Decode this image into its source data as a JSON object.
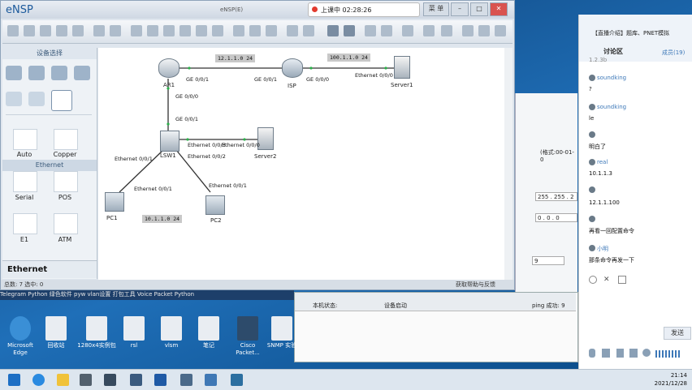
{
  "app": {
    "name": "eNSP",
    "window_title": "eNSP(E)",
    "recording": "上课中 02:28:26",
    "menu_label": "菜 单"
  },
  "left_panel": {
    "header": "设备选择",
    "section": "Ethernet",
    "cables": [
      {
        "label": "Auto",
        "icon": "auto-cable-icon"
      },
      {
        "label": "Copper",
        "icon": "copper-cable-icon"
      },
      {
        "label": "Serial",
        "icon": "serial-cable-icon"
      },
      {
        "label": "POS",
        "icon": "pos-cable-icon"
      },
      {
        "label": "E1",
        "icon": "e1-cable-icon"
      },
      {
        "label": "ATM",
        "icon": "atm-cable-icon"
      }
    ],
    "footer": "Ethernet"
  },
  "topology": {
    "net_ar1_isp": "12.1.1.0 24",
    "net_isp_server": "100.1.1.0 24",
    "net_lan": "10.1.1.0 24",
    "devices": {
      "ar1": "AR1",
      "isp": "ISP",
      "server1": "Server1",
      "lsw1": "LSW1",
      "server2": "Server2",
      "pc1": "PC1",
      "pc2": "PC2"
    },
    "ports": {
      "ar1_ge001": "GE 0/0/1",
      "isp_ge001": "GE 0/0/1",
      "isp_ge000": "GE 0/0/0",
      "server1_eth": "Ethernet 0/0/0",
      "ar1_ge000": "GE 0/0/0",
      "lsw1_ge001": "GE 0/0/1",
      "lsw1_e003": "Ethernet 0/0/3",
      "server2_eth": "Ethernet 0/0/0",
      "lsw1_e001": "Ethernet 0/0/1",
      "lsw1_e002": "Ethernet 0/0/2",
      "pc1_eth": "Ethernet 0/0/1",
      "pc2_eth": "Ethernet 0/0/1"
    }
  },
  "status_bar": {
    "left": "总数: 7  选中: 0",
    "right": "获取帮助与反馈"
  },
  "config_pane": {
    "format_hint": "(格式:00-01-0",
    "mask": "255 . 255 . 2",
    "gateway": "0 . 0 . 0",
    "count": "9"
  },
  "terminal": {
    "label": "本机状态:",
    "state": "设备启动",
    "ping": "ping 成功: 9"
  },
  "chat": {
    "title_tabs": "【直播介绍】题库、PNET模拟",
    "tab_discuss": "讨论区",
    "tab_members": "成员(19)",
    "top_fragment": "1.2.3b",
    "messages": [
      {
        "user": "soundking",
        "text": "?"
      },
      {
        "user": "soundking",
        "text": "le"
      },
      {
        "user": "",
        "text": "明白了"
      },
      {
        "user": "real",
        "text": "10.1.1.3"
      },
      {
        "user": "",
        "text": "12.1.1.100"
      },
      {
        "user": "",
        "text": "再看一回配置命令"
      },
      {
        "user": "小明",
        "text": "那条命令再发一下"
      }
    ],
    "send": "发送"
  },
  "desktop": {
    "ticker": "Telegram  Python  绿色软件  pyw  vlan设置  打包工具  Voice Packet  Python",
    "icons": [
      {
        "label": "Microsoft Edge",
        "icon": "edge-icon"
      },
      {
        "label": "回收站",
        "icon": "recycle-bin-icon"
      },
      {
        "label": "1280x4实例包",
        "icon": "file-icon"
      },
      {
        "label": "rsl",
        "icon": "file-icon"
      },
      {
        "label": "vlsm",
        "icon": "file-icon"
      },
      {
        "label": "笔记",
        "icon": "file-icon"
      },
      {
        "label": "Cisco Packet...",
        "icon": "cisco-packet-tracer-icon"
      },
      {
        "label": "SNMP 实验",
        "icon": "file-icon"
      }
    ]
  },
  "taskbar": {
    "time": "21:14",
    "date": "2021/12/28"
  }
}
